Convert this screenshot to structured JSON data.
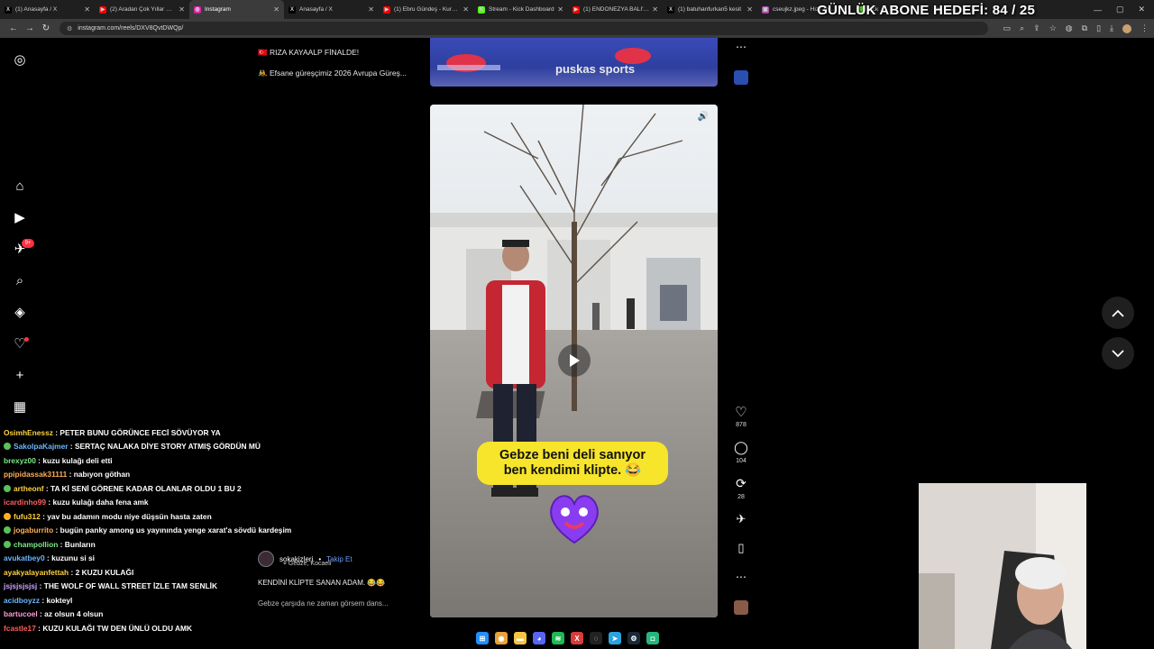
{
  "stream_overlay": {
    "goal_text": "GÜNLÜK ABONE HEDEFİ: 84 / 25"
  },
  "browser": {
    "tabs": [
      {
        "title": "(1) Anasayfa / X",
        "icon": "x-logo-icon",
        "color": "#000000",
        "glyph": "X"
      },
      {
        "title": "(2) Aradan Çok Yıllar Geçti",
        "icon": "youtube-icon",
        "color": "#ff0000",
        "glyph": "▶"
      },
      {
        "title": "Instagram",
        "icon": "instagram-icon",
        "color": "#d6249f",
        "glyph": "◎"
      },
      {
        "title": "Anasayfa / X",
        "icon": "x-logo-icon",
        "color": "#000000",
        "glyph": "X"
      },
      {
        "title": "(1) Ebru Gündeş - Kurşun",
        "icon": "youtube-icon",
        "color": "#ff0000",
        "glyph": "▶"
      },
      {
        "title": "Stream - Kick Dashboard",
        "icon": "kick-icon",
        "color": "#53fc18",
        "glyph": "K"
      },
      {
        "title": "(1) ENDONEZYA BALI'BU",
        "icon": "youtube-icon",
        "color": "#ff0000",
        "glyph": "▶"
      },
      {
        "title": "(1) batuhanfurkan5 kesit",
        "icon": "x-logo-icon",
        "color": "#000000",
        "glyph": "X"
      },
      {
        "title": "cseujkz.jpeg - Hızlı Resim",
        "icon": "image-icon",
        "color": "#a64ca6",
        "glyph": "▣"
      },
      {
        "title": "Kick",
        "icon": "kick-icon",
        "color": "#53fc18",
        "glyph": "K"
      }
    ],
    "active_tab": 2,
    "url": "instagram.com/reels/DXV8QvtDWQp/"
  },
  "sidebar": {
    "items": [
      {
        "name": "instagram-logo-icon",
        "glyph": "◎"
      },
      {
        "name": "home-icon",
        "glyph": "⌂"
      },
      {
        "name": "reels-icon",
        "glyph": "▶"
      },
      {
        "name": "messages-icon",
        "glyph": "✈"
      },
      {
        "name": "search-icon",
        "glyph": "⌕"
      },
      {
        "name": "explore-icon",
        "glyph": "◈"
      },
      {
        "name": "notifications-icon",
        "glyph": "♡"
      },
      {
        "name": "create-icon",
        "glyph": "+"
      },
      {
        "name": "dashboard-icon",
        "glyph": "▦"
      }
    ],
    "messages_badge": "9+"
  },
  "previous_reel": {
    "line1": "🇹🇷 RIZA KAYAALP FİNALDE!",
    "line2": "🤼 Efsane güreşçimiz 2026 Avrupa Güreş...",
    "watermark": "puskas sports"
  },
  "reel": {
    "caption_line1": "Gebze beni deli sanıyor",
    "caption_line2": "ben kendimi klipte. 😂",
    "username": "sokakizleri",
    "separator": "•",
    "follow": "Takip Et",
    "location": "Gebze, Kocaeli",
    "caption": "KENDİNİ KLİPTE SANAN ADAM. 😂😂",
    "caption_more": "Gebze çarşıda ne zaman görsem dans...",
    "likes": "878",
    "comments": "104",
    "reposts": "28"
  },
  "chat": [
    {
      "user": "OsimhEnessz",
      "color": "#ffd23f",
      "msg": "PETER BUNU GÖRÜNCE FECİ SÖVÜYOR YA",
      "icon": ""
    },
    {
      "user": "SakolpaKajmer",
      "color": "#6ab7ff",
      "msg": "SERTAÇ NALAKA DİYE STORY ATMIŞ GÖRDÜN MÜ",
      "icon": "#58c25a"
    },
    {
      "user": "brexyz00",
      "color": "#7ee787",
      "msg": "kuzu kulağı deli etti",
      "icon": ""
    },
    {
      "user": "ppipidassak31111",
      "color": "#ffae57",
      "msg": "nabıyon göthan",
      "icon": ""
    },
    {
      "user": "artheonf",
      "color": "#ffd23f",
      "msg": "TA Kİ SENİ GÖRENE KADAR OLANLAR OLDU 1 BU 2",
      "icon": "#58c25a"
    },
    {
      "user": "icardinho99",
      "color": "#ff5f5f",
      "msg": "kuzu kulağı daha fena amk",
      "icon": ""
    },
    {
      "user": "fufu312",
      "color": "#ffd23f",
      "msg": "yav bu adamın modu niye düşsün hasta zaten",
      "icon": "#ffb020"
    },
    {
      "user": "jogaburrito",
      "color": "#ffae57",
      "msg": "bugün panky among us yayınında yenge xarat'a sövdü kardeşim",
      "icon": "#58c25a"
    },
    {
      "user": "champollion",
      "color": "#7ee787",
      "msg": "Bunların",
      "icon": "#58c25a"
    },
    {
      "user": "avukatbey0",
      "color": "#6ab7ff",
      "msg": "kuzunu si si",
      "icon": ""
    },
    {
      "user": "ayakyalayanfettah",
      "color": "#ffd23f",
      "msg": "2 KUZU KULAĞI",
      "icon": ""
    },
    {
      "user": "jsjsjsjsjsj",
      "color": "#c9a4ff",
      "msg": "THE WOLF OF WALL STREET İZLE TAM SENLİK",
      "icon": ""
    },
    {
      "user": "acidboyzz",
      "color": "#6ab7ff",
      "msg": "kokteyl",
      "icon": ""
    },
    {
      "user": "bartucoel",
      "color": "#ff9edb",
      "msg": "az olsun 4 olsun",
      "icon": ""
    },
    {
      "user": "fcastle17",
      "color": "#ff5f5f",
      "msg": "KUZU KULAĞI TW DEN ÜNLÜ OLDU AMK",
      "icon": ""
    }
  ],
  "taskbar": [
    {
      "name": "windows-start-icon",
      "color": "#1e90ff",
      "glyph": "⊞"
    },
    {
      "name": "chrome-icon",
      "color": "#e8a33b",
      "glyph": "◉"
    },
    {
      "name": "file-explorer-icon",
      "color": "#f5c542",
      "glyph": "▬"
    },
    {
      "name": "discord-icon",
      "color": "#5865f2",
      "glyph": "◕"
    },
    {
      "name": "spotify-icon",
      "color": "#1db954",
      "glyph": "≋"
    },
    {
      "name": "x-app-icon",
      "color": "#d83b3b",
      "glyph": "X"
    },
    {
      "name": "obs-icon",
      "color": "#222222",
      "glyph": "◌"
    },
    {
      "name": "telegram-icon",
      "color": "#2aa3e0",
      "glyph": "➤"
    },
    {
      "name": "steam-icon",
      "color": "#1b2838",
      "glyph": "⚙"
    },
    {
      "name": "app-icon",
      "color": "#25b67e",
      "glyph": "◘"
    }
  ]
}
